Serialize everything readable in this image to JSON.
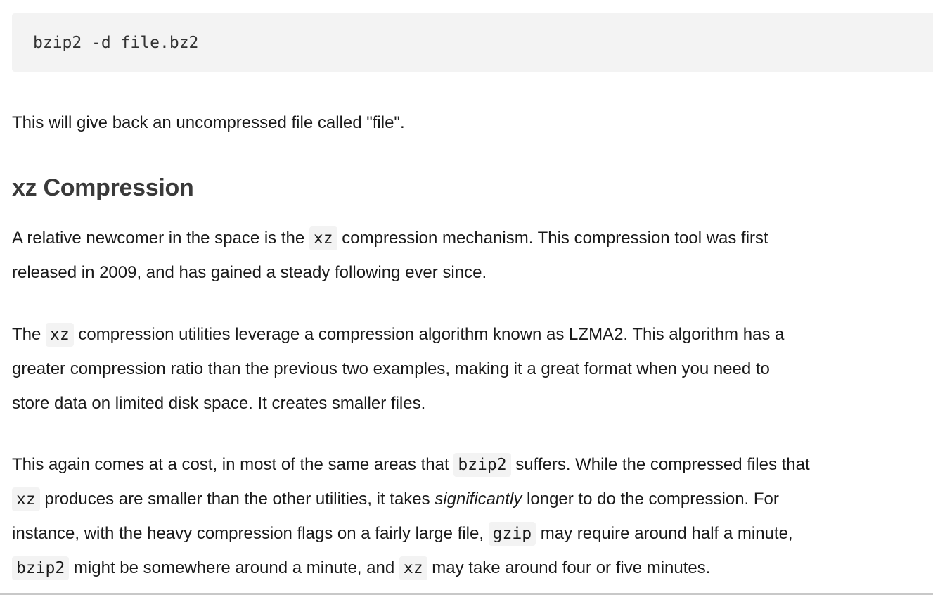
{
  "code_block": {
    "command": "bzip2 -d file.bz2"
  },
  "para_result": "This will give back an uncompressed file called \"file\".",
  "heading": "xz Compression",
  "para1": {
    "l1_a": "A relative newcomer in the space is the ",
    "l1_code": "xz",
    "l1_b": " compression mechanism. This compression tool was first",
    "l2": "released in 2009, and has gained a steady following ever since."
  },
  "para2": {
    "l1_a": "The ",
    "l1_code": "xz",
    "l1_b": " compression utilities leverage a compression algorithm known as LZMA2. This algorithm has a",
    "l2": "greater compression ratio than the previous two examples, making it a great format when you need to",
    "l3": "store data on limited disk space. It creates smaller files."
  },
  "para3": {
    "l1_a": "This again comes at a cost, in most of the same areas that ",
    "l1_code": "bzip2",
    "l1_b": " suffers. While the compressed files that",
    "l2_code": "xz",
    "l2_a": " produces are smaller than the other utilities, it takes ",
    "l2_em": "significantly",
    "l2_b": " longer to do the compression. For",
    "l3_a": "instance, with the heavy compression flags on a fairly large file, ",
    "l3_code": "gzip",
    "l3_b": " may require around half a minute,",
    "l4_code1": "bzip2",
    "l4_a": " might be somewhere around a minute, and ",
    "l4_code2": "xz",
    "l4_b": " may take around four or five minutes."
  }
}
